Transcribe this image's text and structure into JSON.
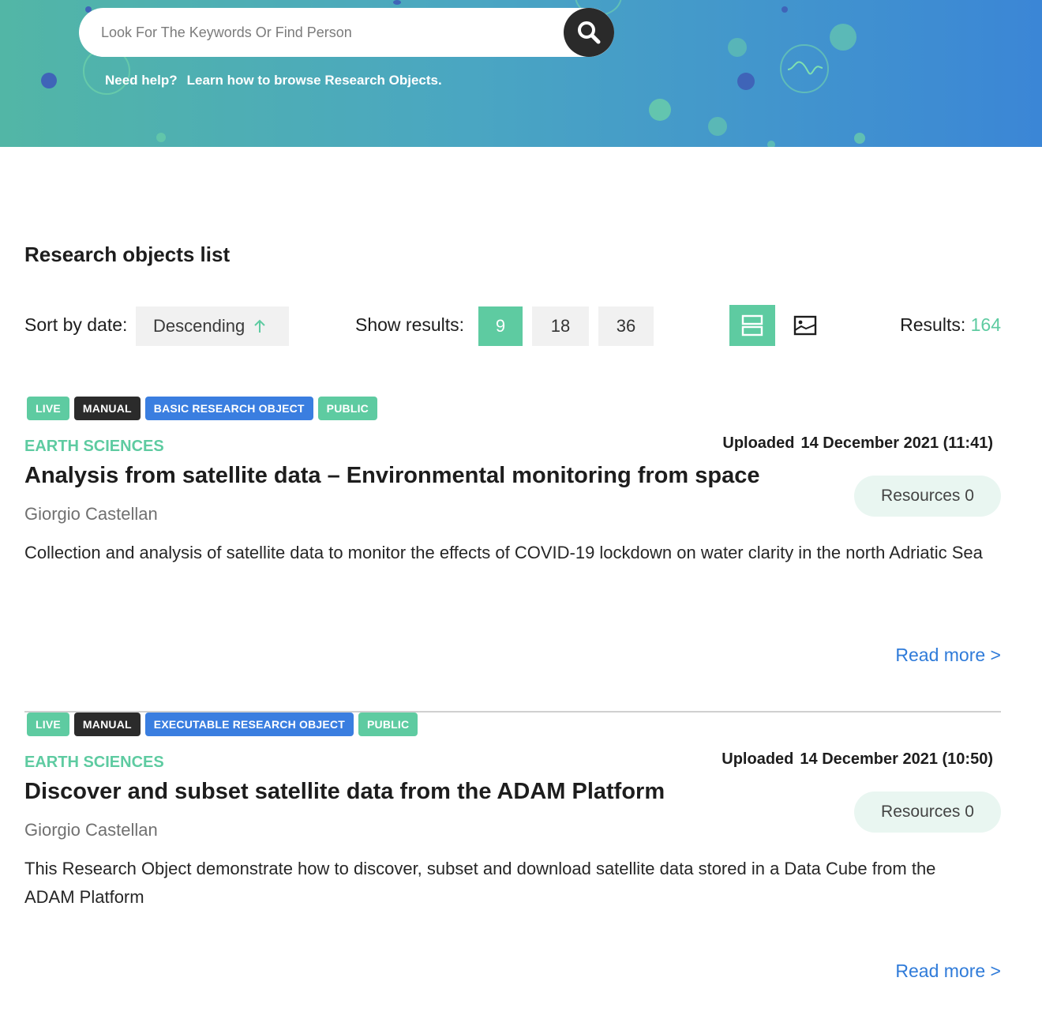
{
  "search": {
    "placeholder": "Look For The Keywords Or Find Person"
  },
  "help": {
    "prefix": "Need help?",
    "link": "Learn how to browse Research Objects."
  },
  "list": {
    "title": "Research objects list",
    "sort_label": "Sort by date:",
    "sort_value": "Descending",
    "show_label": "Show results:",
    "page_sizes": [
      "9",
      "18",
      "36"
    ],
    "active_page_size": "9",
    "results_label": "Results:",
    "results_count": "164"
  },
  "items": [
    {
      "badges": [
        "LIVE",
        "MANUAL",
        "BASIC RESEARCH OBJECT",
        "PUBLIC"
      ],
      "category": "EARTH SCIENCES",
      "uploaded_label": "Uploaded",
      "uploaded_date": "14 December 2021 (11:41)",
      "title": "Analysis from satellite data – Environmental monitoring from space",
      "author": "Giorgio Castellan",
      "resources": "Resources 0",
      "description": "Collection and analysis of satellite data to monitor the effects of COVID-19 lockdown on water clarity in the north Adriatic Sea",
      "read_more": "Read more >"
    },
    {
      "badges": [
        "LIVE",
        "MANUAL",
        "EXECUTABLE RESEARCH OBJECT",
        "PUBLIC"
      ],
      "category": "EARTH SCIENCES",
      "uploaded_label": "Uploaded",
      "uploaded_date": "14 December 2021 (10:50)",
      "title": "Discover and subset satellite data from the ADAM Platform",
      "author": "Giorgio Castellan",
      "resources": "Resources 0",
      "description": "This Research Object demonstrate how to discover, subset and download satellite data stored in a Data Cube from the ADAM Platform",
      "read_more": "Read more >"
    }
  ],
  "icons": {
    "search": "search-icon",
    "sort_arrow": "arrow-up-icon",
    "list_view": "list-view-icon",
    "card_view": "image-card-view-icon"
  },
  "colors": {
    "accent": "#5ecba1",
    "type_badge": "#3a7ee0",
    "dark_badge": "#2b2b2b",
    "link": "#2f7bd9"
  }
}
